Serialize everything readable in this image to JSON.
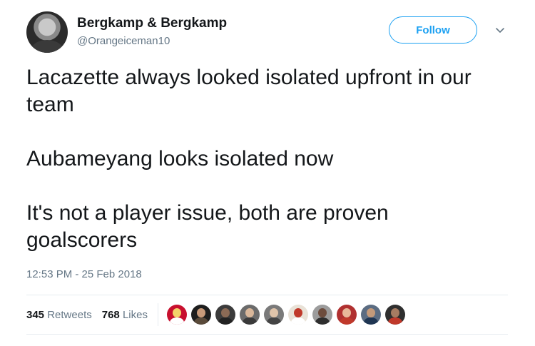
{
  "tweet": {
    "author": {
      "display_name": "Bergkamp & Bergkamp",
      "handle": "@Orangeiceman10"
    },
    "follow_label": "Follow",
    "paragraphs": [
      "Lacazette always looked isolated upfront in our team",
      "Aubameyang looks isolated now",
      "It's not a player issue, both are proven goalscorers"
    ],
    "timestamp": "12:53 PM - 25 Feb 2018",
    "retweets": {
      "count": "345",
      "label": "Retweets"
    },
    "likes": {
      "count": "768",
      "label": "Likes"
    },
    "likers": [
      {
        "bg": "#c8102e",
        "face": "#f3d36b",
        "body": "#ffffff",
        "name": "arsenal-crest-avatar"
      },
      {
        "bg": "#1e1e1e",
        "face": "#c89a7a",
        "body": "#5a4a3a",
        "name": "liker-avatar"
      },
      {
        "bg": "#3b3b3b",
        "face": "#8b6a55",
        "body": "#222222",
        "name": "liker-avatar"
      },
      {
        "bg": "#6b6b6b",
        "face": "#d9b79a",
        "body": "#3a3a3a",
        "name": "liker-avatar"
      },
      {
        "bg": "#7a7a7a",
        "face": "#e0c4aa",
        "body": "#444444",
        "name": "liker-avatar"
      },
      {
        "bg": "#e9e2d7",
        "face": "#c0392b",
        "body": "#ffffff",
        "name": "liker-avatar"
      },
      {
        "bg": "#9c9c9c",
        "face": "#6d4c3d",
        "body": "#2e2e2e",
        "name": "liker-avatar"
      },
      {
        "bg": "#b03030",
        "face": "#e8b89a",
        "body": "#c0392b",
        "name": "liker-avatar"
      },
      {
        "bg": "#5b6c82",
        "face": "#c49a7a",
        "body": "#1f3552",
        "name": "liker-avatar"
      },
      {
        "bg": "#2f2f2f",
        "face": "#a67c62",
        "body": "#c0392b",
        "name": "liker-avatar"
      }
    ]
  }
}
